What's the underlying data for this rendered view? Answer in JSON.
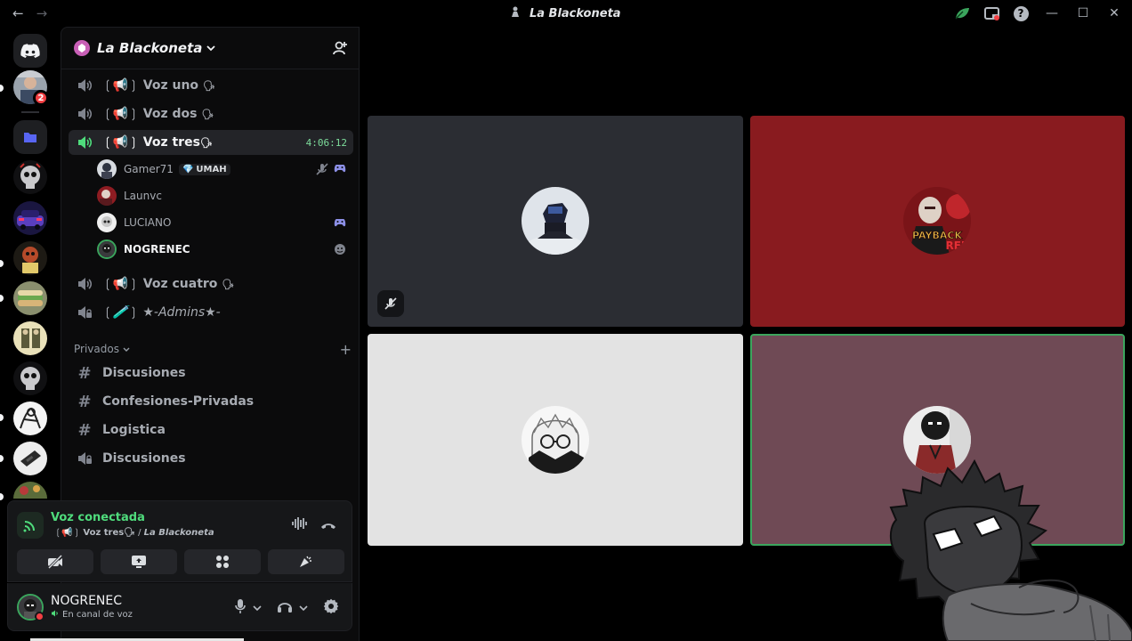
{
  "window": {
    "title": "La Blackoneta",
    "back_arrow": "←",
    "forward_arrow": "→",
    "help": "?",
    "minimize": "—",
    "maximize": "☐",
    "close": "✕"
  },
  "rail": {
    "dm_badge": "2"
  },
  "server": {
    "name": "La Blackoneta",
    "chevron": "⌄"
  },
  "channels": [
    {
      "prefix": "❲📢❳",
      "name": "Voz uno",
      "emoji": "🗣",
      "type": "voice"
    },
    {
      "prefix": "❲📢❳",
      "name": "Voz dos",
      "emoji": "🗣",
      "type": "voice"
    },
    {
      "prefix": "❲📢❳",
      "name": "Voz tres",
      "emoji": "🗣",
      "type": "voice",
      "timer": "4:06:12"
    },
    {
      "prefix": "❲📢❳",
      "name": "Voz cuatro",
      "emoji": "🗣",
      "type": "voice"
    },
    {
      "prefix": "❲🧪❳",
      "name": "★-Admins★-",
      "emoji": "",
      "type": "voice-locked"
    }
  ],
  "voice_users": [
    {
      "name": "Gamer71",
      "tag": "UMAH",
      "tag_icon": "💎"
    },
    {
      "name": "Launvc"
    },
    {
      "name": "LUCIANO"
    },
    {
      "name": "NOGRENEC"
    }
  ],
  "category": {
    "label": "Privados",
    "chevron": "⌄",
    "add": "+"
  },
  "text_channels": [
    {
      "name": "Discusiones",
      "type": "text"
    },
    {
      "name": "Confesiones-Privadas",
      "type": "text"
    },
    {
      "name": "Logistica",
      "type": "text"
    },
    {
      "name": "Discusiones",
      "type": "voice-locked"
    }
  ],
  "voice_panel": {
    "status": "Voz conectada",
    "channel_prefix": "❲📢❳",
    "channel": "Voz tres🗣",
    "separator": "/",
    "server": "La Blackoneta"
  },
  "user": {
    "name": "NOGRENEC",
    "status": "En canal de voz"
  },
  "colors": {
    "connected_green": "#4fdc7c",
    "tile_dark": "#2b2d33",
    "tile_red": "#891b1f",
    "tile_light": "#e3e3e3",
    "tile_mauve": "#6f4a55",
    "speaking_border": "#3ba55d"
  }
}
